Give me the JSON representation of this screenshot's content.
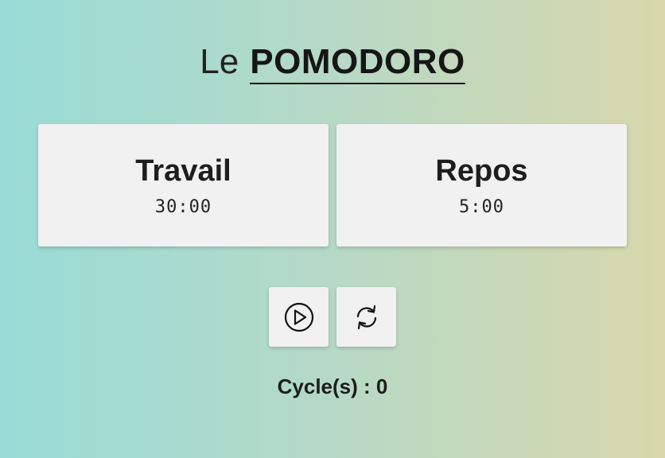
{
  "header": {
    "prefix": "Le",
    "title": "POMODORO"
  },
  "timers": [
    {
      "label": "Travail",
      "time": "30:00"
    },
    {
      "label": "Repos",
      "time": "5:00"
    }
  ],
  "controls": {
    "play_icon": "play-circle-icon",
    "reset_icon": "refresh-icon"
  },
  "cycles": {
    "text": "Cycle(s) : 0"
  },
  "colors": {
    "background_start": "#98dcd7",
    "background_end": "#d8d8ab",
    "card": "#f1f1f1",
    "text": "#1a1a1a"
  }
}
